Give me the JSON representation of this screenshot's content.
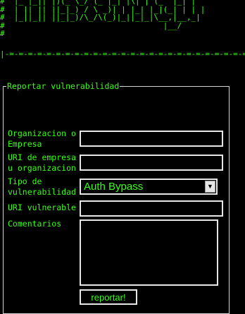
{
  "banner": {
    "ascii_art": "#  |_ |_|| |)(_ \\_/ (_ |_| |\\| | (_  |_| |  \n#  | || || ||_|_) / \\ _)| | |_| |_|(_| | | |  \n#  |_||_|| ||_|_)/\\_/\\(_)|_||_|_|\\__,|__,_|  \n#                                  |__/        \n#",
    "separator": "|-=-=-=-=-=-=-=-=-=-=-=-=-=-=-=-=-=-=-=-=-=-=-=-=-=-=-=-=-="
  },
  "form": {
    "legend": "Reportar vulnerabilidad",
    "fields": [
      {
        "label_line1": "Organizacion o",
        "label_line2": "Empresa",
        "value": ""
      },
      {
        "label_line1": "URI de empresa",
        "label_line2": "u organizacion",
        "value": ""
      },
      {
        "label_line1": "Tipo de",
        "label_line2": "vulnerabilidad",
        "selected": "Auth Bypass",
        "icon": "chevron-down-icon"
      },
      {
        "label": "URI vulnerable",
        "value": ""
      },
      {
        "label": "Comentarios",
        "value": ""
      }
    ],
    "submit_label": "reportar!"
  },
  "colors": {
    "background": "#000000",
    "text": "#39ff14",
    "field_border": "#e6e6e6",
    "fieldset_border": "#d4d4d4"
  }
}
